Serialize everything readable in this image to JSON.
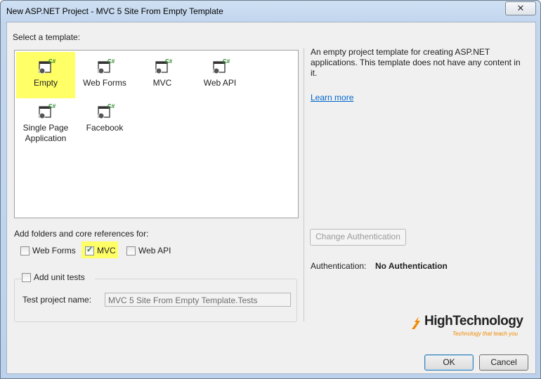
{
  "window": {
    "title": "New ASP.NET Project - MVC 5 Site From Empty Template",
    "close_glyph": "✕"
  },
  "templates": {
    "heading": "Select a template:",
    "items": [
      {
        "label": "Empty",
        "selected": true,
        "icon": "project-template-icon"
      },
      {
        "label": "Web Forms",
        "selected": false,
        "icon": "project-template-icon"
      },
      {
        "label": "MVC",
        "selected": false,
        "icon": "project-template-icon"
      },
      {
        "label": "Web API",
        "selected": false,
        "icon": "project-template-icon"
      },
      {
        "label": "Single Page\nApplication",
        "selected": false,
        "icon": "project-template-icon"
      },
      {
        "label": "Facebook",
        "selected": false,
        "icon": "project-template-icon"
      }
    ],
    "icon_badge": "C#"
  },
  "description": {
    "text": "An empty project template for creating ASP.NET applications. This template does not have any content in it.",
    "learn_more": "Learn more"
  },
  "references": {
    "heading": "Add folders and core references for:",
    "options": [
      {
        "label": "Web Forms",
        "checked": false
      },
      {
        "label": "MVC",
        "checked": true
      },
      {
        "label": "Web API",
        "checked": false
      }
    ]
  },
  "unit_tests": {
    "label": "Add unit tests",
    "checked": false,
    "project_name_label": "Test project name:",
    "project_name_value": "MVC 5 Site From Empty Template.Tests"
  },
  "auth": {
    "change_button": "Change Authentication",
    "label": "Authentication:",
    "value": "No Authentication"
  },
  "logo": {
    "brand": "HighTechnology",
    "tagline": "Technology that teach you"
  },
  "buttons": {
    "ok": "OK",
    "cancel": "Cancel"
  },
  "colors": {
    "highlight": "#ffff66",
    "link": "#0066cc",
    "logo_accent": "#f08a00"
  }
}
